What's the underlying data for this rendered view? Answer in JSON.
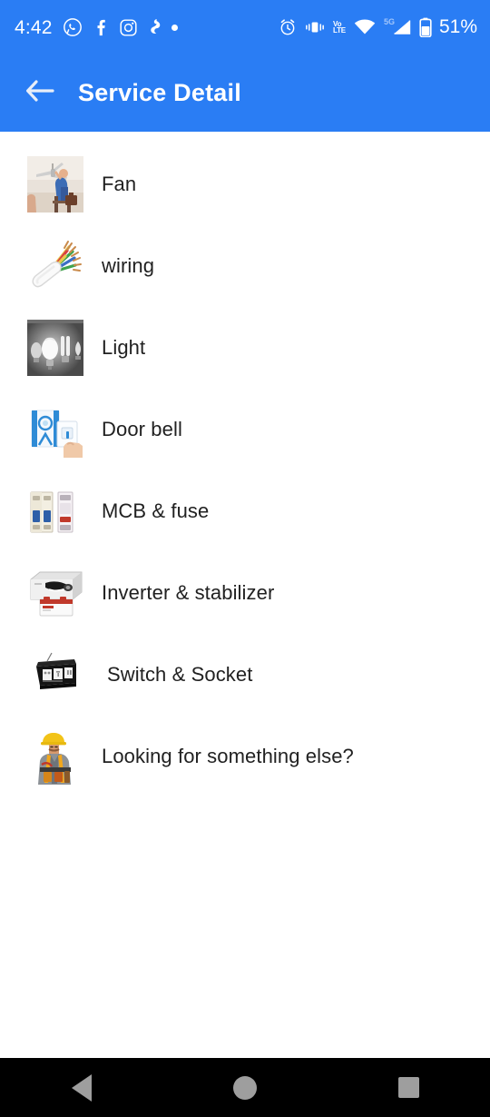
{
  "status_bar": {
    "time": "4:42",
    "battery_percent": "51%",
    "volte_top": "Vo",
    "volte_bottom": "LTE",
    "network_gen": "5G",
    "left_icons": [
      "whatsapp-icon",
      "facebook-icon",
      "instagram-icon",
      "app-icon",
      "dot-icon"
    ],
    "right_icons": [
      "alarm-icon",
      "vibrate-icon",
      "volte-icon",
      "wifi-icon",
      "signal-icon",
      "battery-icon"
    ],
    "background_color": "#2A7DF4"
  },
  "app_bar": {
    "title": "Service Detail",
    "back_icon": "arrow-back-icon",
    "background_color": "#2A7DF4",
    "title_color": "#FFFFFF"
  },
  "service_list": {
    "items": [
      {
        "label": "Fan",
        "icon": "ceiling-fan-installation-photo"
      },
      {
        "label": "wiring",
        "icon": "electrical-cable-photo"
      },
      {
        "label": "Light",
        "icon": "light-bulbs-photo"
      },
      {
        "label": "Door bell",
        "icon": "doorbell-photo"
      },
      {
        "label": "MCB & fuse",
        "icon": "circuit-breaker-photo"
      },
      {
        "label": "Inverter & stabilizer",
        "icon": "inverter-battery-photo"
      },
      {
        "label": "Switch & Socket",
        "icon": "switch-socket-photo"
      },
      {
        "label": "Looking for something else?",
        "icon": "electrician-worker-photo"
      }
    ],
    "text_color": "#212121",
    "background_color": "#FFFFFF"
  },
  "nav_bar": {
    "background_color": "#000000",
    "icon_color": "#9E9E9E",
    "buttons": [
      {
        "name": "back-button",
        "icon": "triangle-back-icon"
      },
      {
        "name": "home-button",
        "icon": "circle-home-icon"
      },
      {
        "name": "recents-button",
        "icon": "square-recents-icon"
      }
    ]
  }
}
